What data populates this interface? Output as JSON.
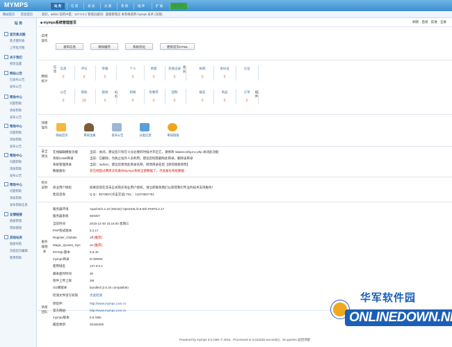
{
  "brand": {
    "logo": "MYMPS"
  },
  "nav": {
    "tabs": [
      {
        "label": "站 务",
        "active": true
      },
      {
        "label": "信 息"
      },
      {
        "label": "会 员"
      },
      {
        "label": "分 类"
      },
      {
        "label": "系 统"
      },
      {
        "label": "插 件"
      },
      {
        "label": "扩 展"
      },
      {
        "label": "全 部 ▾",
        "green": true
      }
    ]
  },
  "subbar": {
    "frontend": "网站首页",
    "backend": "后台首页",
    "welcome": "您好，admin 您的IP是：127.0.0.1 管理员级别：超级管理员 本系统采用 mymps 技术 (注销)"
  },
  "sidebar": {
    "title": "站 务",
    "groups": [
      {
        "label": "首页焦点图",
        "items": [
          "焦点图列表",
          "上传焦点图"
        ]
      },
      {
        "label": "关于我们",
        "items": [
          "修改设置"
        ]
      },
      {
        "label": "网站公告",
        "items": [
          "已发布公告",
          "发布公告"
        ]
      },
      {
        "label": "帮助中心",
        "items": [
          "问题帮助",
          "添加帮助",
          "发布公告"
        ]
      },
      {
        "label": "帮助中心",
        "items": [
          "问题帮助",
          "添加帮助",
          "发布公告"
        ]
      },
      {
        "label": "帮助中心",
        "items": [
          "问题帮助",
          "添加帮助",
          "发布公告"
        ]
      },
      {
        "label": "帮助中心",
        "items": [
          "问题帮助",
          "添加帮助",
          "发布帮助信息"
        ]
      },
      {
        "label": "友情链接",
        "items": [
          "链接管理",
          "增加链接"
        ]
      },
      {
        "label": "其他站务",
        "items": [
          "链接导航",
          "页面首页编辑",
          "使用帮助"
        ]
      }
    ]
  },
  "main": {
    "title": "mymps系统管理首页",
    "links": [
      "刷新",
      "后退",
      "前进",
      "全屏"
    ]
  },
  "common_ops": {
    "label": "常用操作",
    "buttons": [
      "发布信息",
      "清除缓存",
      "系统优化",
      "更新首页HTML"
    ]
  },
  "stats": {
    "label": "数据统计",
    "row1_cat_a": "信息",
    "row1_cat_b": "会员",
    "row1": [
      {
        "label": "信息",
        "value": "0"
      },
      {
        "label": "评论",
        "value": "0"
      },
      {
        "label": "举报",
        "value": "0"
      },
      {
        "label": "个人",
        "value": "0"
      },
      {
        "label": "商家",
        "value": "0"
      },
      {
        "label": "充值记录",
        "value": "0"
      },
      {
        "label": "执照",
        "value": "0"
      },
      {
        "label": "身份证",
        "value": "0"
      },
      {
        "label": "认证",
        "value": ""
      }
    ],
    "row2_cat_a": "站务",
    "row2_cat_b": "插件",
    "row2": [
      {
        "label": "公告",
        "value": "0"
      },
      {
        "label": "帮助",
        "value": "18"
      },
      {
        "label": "链接",
        "value": "0"
      },
      {
        "label": "新闻",
        "value": "0"
      },
      {
        "label": "优惠券",
        "value": "0"
      },
      {
        "label": "团购",
        "value": "0"
      },
      {
        "label": "报名",
        "value": "0"
      },
      {
        "label": "商品",
        "value": "0"
      },
      {
        "label": "订单",
        "value": "0"
      }
    ]
  },
  "quick": {
    "label": "快捷操作",
    "items": [
      {
        "label": "网站首页",
        "icon": "home-icon"
      },
      {
        "label": "审核注册",
        "icon": "user-icon"
      },
      {
        "label": "发布公告",
        "icon": "edit-icon"
      },
      {
        "label": "分类信息",
        "icon": "search-doc-icon"
      },
      {
        "label": "审核链接",
        "icon": "globe-icon"
      }
    ]
  },
  "security": {
    "label": "安全建议",
    "rows": [
      {
        "k": "在线编辑模板功能",
        "v": "当前：关闭。建议您只有在十分必要的时候才开启它，请修改 /data/config.inc.php 关闭此功能"
      },
      {
        "k": "系统install目录",
        "v": "当前：已删除，为防止站外人员利用，建议您彻底删除此目录，删除该目录"
      },
      {
        "k": "系统管理目录",
        "v": "当前：/admin，建议您更改此目录名称，修改目录名后【请勿随意修改】"
      },
      {
        "k": "数据备份",
        "v": "您已经超过两周没有备份Mymps系统全部数据了，点此备份系统数据"
      }
    ]
  },
  "purchase": {
    "label": "购买说明",
    "rows": [
      {
        "k": "商业用户授权",
        "v": "如果您现在还未正式购买商业用户授权，请立即联系我们以获得我们专业的技术支持服务！"
      },
      {
        "k": "售前咨询",
        "v": "Q Q：3973597(点击交谈) TEL：13373557791"
      }
    ]
  },
  "server": {
    "label": "服务器相关",
    "rows": [
      {
        "k": "服务器环境",
        "v": "Apache/2.4.10 (Win32) OpenSSL/0.9.8zb PHP/5.2.17"
      },
      {
        "k": "服务器系统",
        "v": "WINNT"
      },
      {
        "k": "当前时间",
        "v": "2015-12-30 15:16:00 星期三"
      },
      {
        "k": "PHP程式版本",
        "v": "5.2.17"
      },
      {
        "k": "Register_Globals",
        "v": "off [推荐]"
      },
      {
        "k": "Magic_Quotes_Gpc",
        "v": "on [推荐]"
      },
      {
        "k": "MYSQL版本",
        "v": "5.5.40"
      },
      {
        "k": "mymps目录",
        "v": "D:/WWW"
      },
      {
        "k": "使用域名",
        "v": "127.0.0.1"
      },
      {
        "k": "脚本超时时间",
        "v": "30"
      },
      {
        "k": "附件上传上限",
        "v": "2M"
      },
      {
        "k": "GD库版本",
        "v": "bundled (2.0.34 compatible)"
      },
      {
        "k": "检测文件读写权限",
        "v": "点此检测"
      }
    ]
  },
  "team": {
    "label": "研发团队",
    "rows": [
      {
        "k": "原软件:",
        "v": "http://www.mymps.com.cn"
      },
      {
        "k": "官方网站:",
        "v": "http://www.mymps.com.cn"
      },
      {
        "k": "mymps版本:",
        "v": "5.5 GBK"
      },
      {
        "k": "最后更新:",
        "v": "20150205"
      }
    ]
  },
  "footer": {
    "text": "Powered by mymps 5.5 GBK © 2015 , Processed in 0.011630 second(s) , 18 queries  返回顶部"
  },
  "watermark": {
    "top": "华军软件园",
    "bottom": "ONLINEDOWN.NET"
  },
  "colors": {
    "nav": "#3c8fd0",
    "accent": "#e86a1a",
    "link": "#2a5f9e",
    "warn": "#d2160c"
  }
}
